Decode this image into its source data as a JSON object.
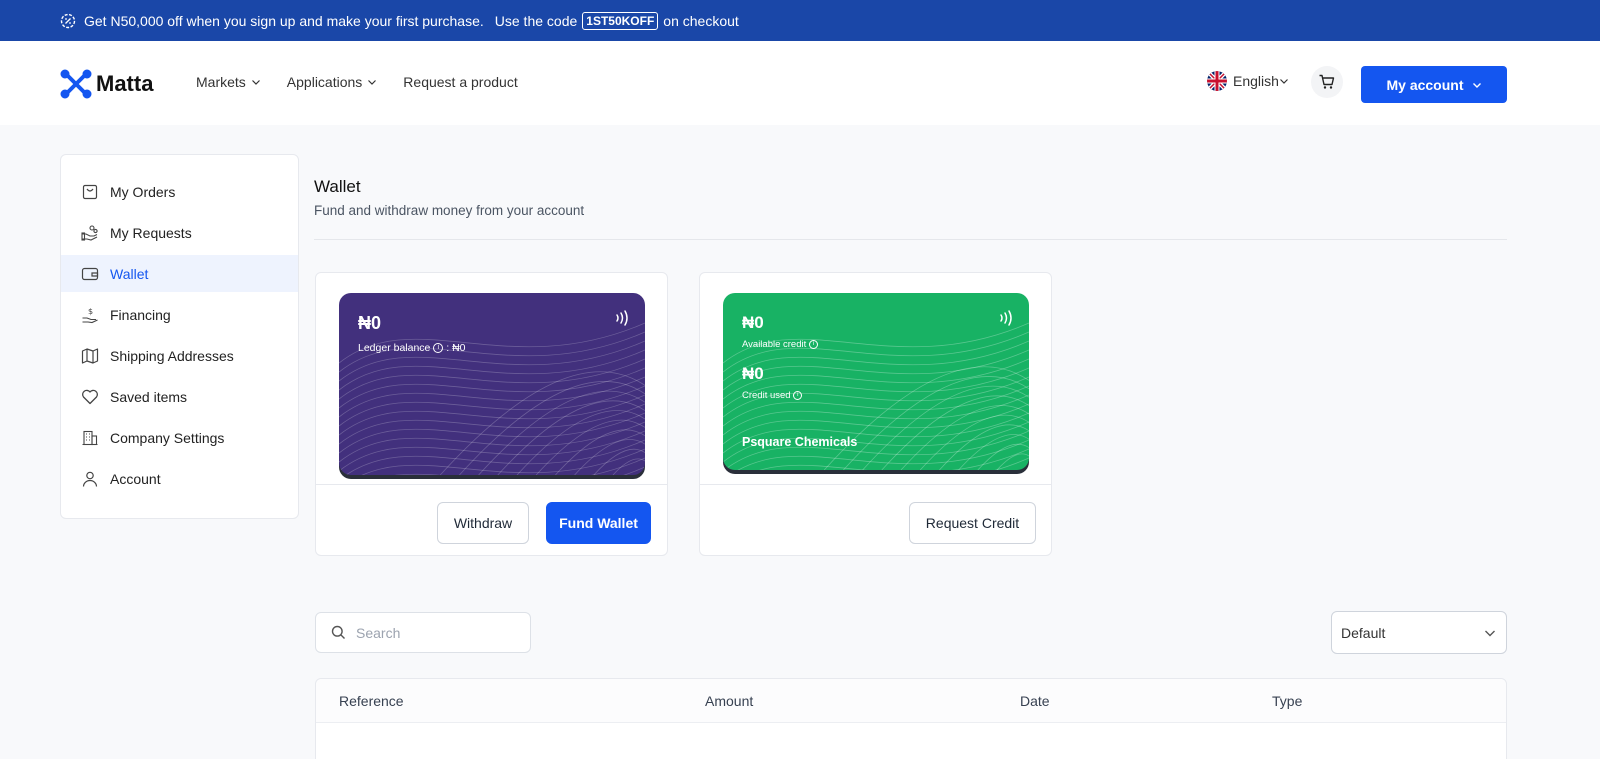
{
  "promo": {
    "text_before": "Get N50,000 off when you sign up and make your first purchase.",
    "text_use": "Use the code",
    "code": "1ST50KOFF",
    "text_after": "on checkout"
  },
  "header": {
    "logo": "Matta",
    "nav": [
      {
        "label": "Markets",
        "dropdown": true
      },
      {
        "label": "Applications",
        "dropdown": true
      },
      {
        "label": "Request a product",
        "dropdown": false
      }
    ],
    "language": "English",
    "account_label": "My account"
  },
  "sidebar": {
    "items": [
      {
        "label": "My Orders",
        "icon": "shopping-bag-icon"
      },
      {
        "label": "My Requests",
        "icon": "hand-coins-icon"
      },
      {
        "label": "Wallet",
        "icon": "wallet-icon",
        "active": true
      },
      {
        "label": "Financing",
        "icon": "hand-dollar-icon"
      },
      {
        "label": "Shipping Addresses",
        "icon": "map-icon"
      },
      {
        "label": "Saved items",
        "icon": "heart-icon"
      },
      {
        "label": "Company Settings",
        "icon": "building-icon"
      },
      {
        "label": "Account",
        "icon": "user-icon"
      }
    ]
  },
  "wallet": {
    "title": "Wallet",
    "subtitle": "Fund and withdraw money from your account",
    "balance_card": {
      "amount": "₦0",
      "ledger_label": "Ledger balance",
      "ledger_value": ": ₦0",
      "withdraw_label": "Withdraw",
      "fund_label": "Fund Wallet",
      "color": "#42307d"
    },
    "credit_card": {
      "available_amount": "₦0",
      "available_label": "Available credit",
      "used_amount": "₦0",
      "used_label": "Credit used",
      "company": "Psquare Chemicals",
      "request_label": "Request Credit",
      "color": "#18b264"
    }
  },
  "filters": {
    "search_placeholder": "Search",
    "sort_selected": "Default"
  },
  "table": {
    "columns": [
      "Reference",
      "Amount",
      "Date",
      "Type"
    ]
  },
  "colors": {
    "primary": "#1456f0",
    "banner": "#1a47a8"
  }
}
